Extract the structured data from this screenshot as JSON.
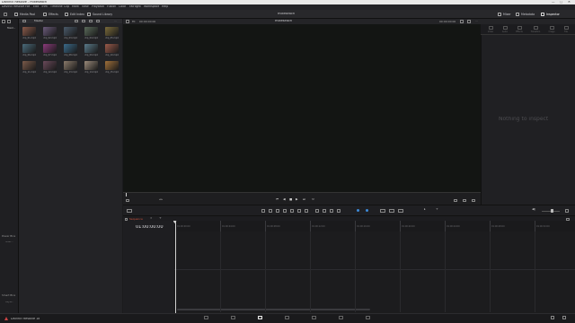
{
  "window": {
    "title": "DaVinci Resolve - mikeseach",
    "controls": [
      "—",
      "□",
      "✕"
    ]
  },
  "menubar": [
    "DaVinci Resolve",
    "File",
    "Edit",
    "Trim",
    "Timeline",
    "Clip",
    "Mark",
    "View",
    "Playback",
    "Fusion",
    "Color",
    "Fairlight",
    "Workspace",
    "Help"
  ],
  "toolbar": {
    "media_pool": "Media Pool",
    "effects": "Effects",
    "edit_index": "Edit Index",
    "sound_library": "Sound Library",
    "project_name": "mikeseach",
    "mixer": "Mixer",
    "metadata": "Metadata",
    "inspector": "Inspector"
  },
  "left_panel": {
    "bin_label": "Mast...",
    "power_bins": "Power Bins",
    "power_bin_item": "Mast...",
    "smart_bins": "Smart Bins",
    "smart_bin_item": "Keyw..."
  },
  "media_pool": {
    "header": "Master",
    "clips": [
      {
        "label": "clip_01.mp4",
        "color": "#8a5a4a"
      },
      {
        "label": "clip_02.mp4",
        "color": "#6a5a7a"
      },
      {
        "label": "clip_03.mp4",
        "color": "#4a5a6a"
      },
      {
        "label": "clip_04.mp4",
        "color": "#5a6a5a"
      },
      {
        "label": "clip_05.mp4",
        "color": "#7a6a3a"
      },
      {
        "label": "clip_06.mp4",
        "color": "#4a6a7a"
      },
      {
        "label": "clip_07.mp4",
        "color": "#8a3a7a"
      },
      {
        "label": "clip_08.mp4",
        "color": "#3a6a8a"
      },
      {
        "label": "clip_09.mp4",
        "color": "#5a7a8a"
      },
      {
        "label": "clip_10.mp4",
        "color": "#9a5a4a"
      },
      {
        "label": "clip_11.mp4",
        "color": "#7a5a4a"
      },
      {
        "label": "clip_12.mp4",
        "color": "#6a4a5a"
      },
      {
        "label": "clip_13.mp4",
        "color": "#8a7a6a"
      },
      {
        "label": "clip_14.mp4",
        "color": "#9a8a7a"
      },
      {
        "label": "clip_15.mp4",
        "color": "#a0703a"
      }
    ]
  },
  "viewer": {
    "zoom": "Fit",
    "left_timecode": "00:00:00:00",
    "title": "mikeseach",
    "right_timecode": "00:00:00:00"
  },
  "inspector": {
    "tabs": [
      "Video",
      "Audio",
      "Effects",
      "Transition",
      "Image",
      "File"
    ],
    "empty_message": "Nothing to inspect"
  },
  "timeline": {
    "tab_name": "Sequence",
    "timecode": "01:00:00:00",
    "ruler": [
      "01:00:00:00",
      "01:00:04:00",
      "01:00:08:00",
      "01:00:12:00",
      "01:00:16:00",
      "01:00:20:00",
      "01:00:24:00",
      "01:00:28:00",
      "01:00:32:00"
    ]
  },
  "bottombar": {
    "app_name": "DaVinci Resolve 18"
  },
  "colors": {
    "accent_blue": "#3d8bd9",
    "timeline_tab_red": "#d4553f",
    "playhead": "#d0d0d0"
  }
}
